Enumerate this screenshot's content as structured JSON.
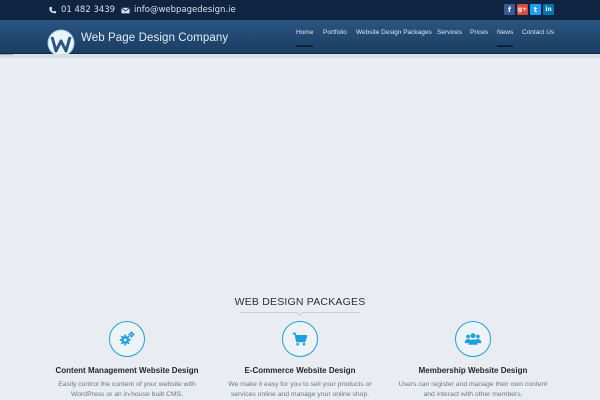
{
  "topbar": {
    "phone": "01 482 3439",
    "email": "info@webpagedesign.ie",
    "social": [
      {
        "name": "facebook",
        "glyph": "f",
        "color": "#3b5998"
      },
      {
        "name": "google-plus",
        "glyph": "g+",
        "color": "#dd4b39"
      },
      {
        "name": "twitter",
        "glyph": "t",
        "color": "#1da1f2"
      },
      {
        "name": "linkedin",
        "glyph": "in",
        "color": "#0077b5"
      }
    ]
  },
  "header": {
    "brand": "Web Page Design Company",
    "nav": [
      "Home",
      "Portfolio",
      "Website Design Packages",
      "Services",
      "Prices",
      "News",
      "Contact Us"
    ],
    "active": [
      "Home",
      "News"
    ]
  },
  "section": {
    "title": "WEB DESIGN PACKAGES"
  },
  "packages": [
    {
      "icon": "cogs-icon",
      "title": "Content Management Website Design",
      "desc1": "Easily control the content of your website with",
      "desc2": "WordPress or an in-house built CMS."
    },
    {
      "icon": "shopping-cart-icon",
      "title": "E-Commerce Website Design",
      "desc1": "We make it easy for you to sell your products or",
      "desc2": "services online and manage your online shop."
    },
    {
      "icon": "users-icon",
      "title": "Membership Website Design",
      "desc1": "Users can register and manage their own content",
      "desc2": "and interact with other members."
    }
  ],
  "colors": {
    "topbar": "#0e2440",
    "header": "#1f4670",
    "accent": "#1ea0e0",
    "background": "#e9edf2"
  }
}
